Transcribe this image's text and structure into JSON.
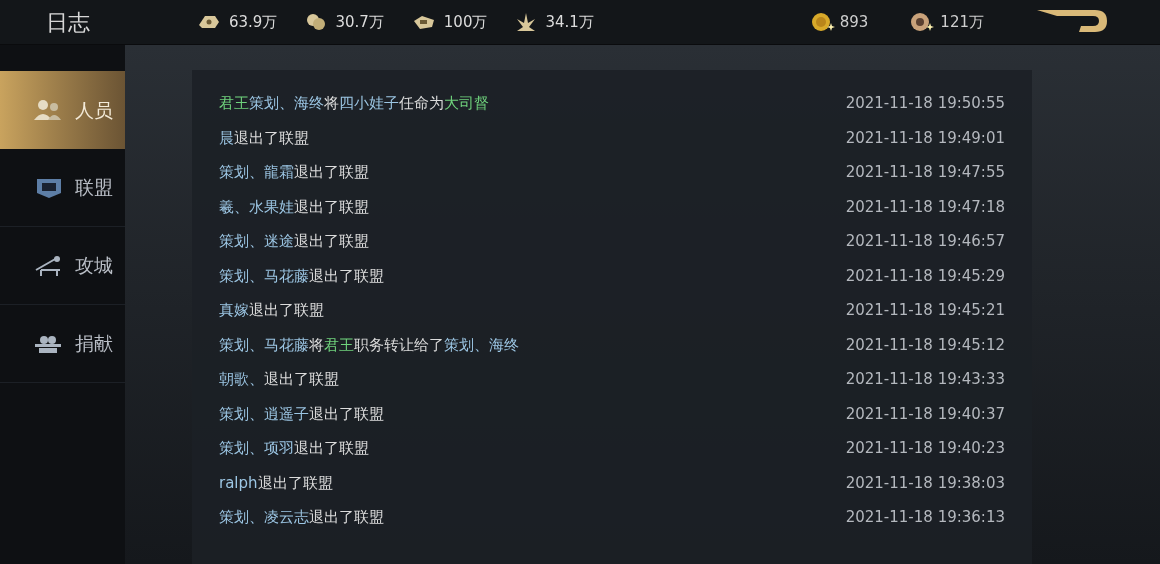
{
  "header": {
    "title": "日志"
  },
  "resources": [
    {
      "kind": "ore",
      "amount": "63.9万"
    },
    {
      "kind": "grain",
      "amount": "30.7万"
    },
    {
      "kind": "iron",
      "amount": "100万"
    },
    {
      "kind": "wood",
      "amount": "34.1万"
    }
  ],
  "currencies": [
    {
      "kind": "gold",
      "amount": "893"
    },
    {
      "kind": "coin",
      "amount": "121万"
    }
  ],
  "sidebar": {
    "items": [
      {
        "kind": "people",
        "label": "人员",
        "selected": true
      },
      {
        "kind": "alliance",
        "label": "联盟",
        "selected": false
      },
      {
        "kind": "siege",
        "label": "攻城",
        "selected": false
      },
      {
        "kind": "donate",
        "label": "捐献",
        "selected": false
      }
    ]
  },
  "log": [
    {
      "segments": [
        {
          "kind": "title",
          "text": "君王"
        },
        {
          "kind": "name",
          "text": "策划、海终"
        },
        {
          "kind": "text",
          "text": "将"
        },
        {
          "kind": "name",
          "text": "四小娃子"
        },
        {
          "kind": "text",
          "text": "任命为"
        },
        {
          "kind": "title",
          "text": "大司督"
        }
      ],
      "time": "2021-11-18 19:50:55"
    },
    {
      "segments": [
        {
          "kind": "name",
          "text": "晨"
        },
        {
          "kind": "text",
          "text": "退出了联盟"
        }
      ],
      "time": "2021-11-18 19:49:01"
    },
    {
      "segments": [
        {
          "kind": "name",
          "text": "策划、龍霜"
        },
        {
          "kind": "text",
          "text": "退出了联盟"
        }
      ],
      "time": "2021-11-18 19:47:55"
    },
    {
      "segments": [
        {
          "kind": "name",
          "text": "羲、水果娃"
        },
        {
          "kind": "text",
          "text": "退出了联盟"
        }
      ],
      "time": "2021-11-18 19:47:18"
    },
    {
      "segments": [
        {
          "kind": "name",
          "text": "策划、迷途"
        },
        {
          "kind": "text",
          "text": "退出了联盟"
        }
      ],
      "time": "2021-11-18 19:46:57"
    },
    {
      "segments": [
        {
          "kind": "name",
          "text": "策划、马花藤"
        },
        {
          "kind": "text",
          "text": "退出了联盟"
        }
      ],
      "time": "2021-11-18 19:45:29"
    },
    {
      "segments": [
        {
          "kind": "name",
          "text": "真嫁"
        },
        {
          "kind": "text",
          "text": "退出了联盟"
        }
      ],
      "time": "2021-11-18 19:45:21"
    },
    {
      "segments": [
        {
          "kind": "name",
          "text": "策划、马花藤"
        },
        {
          "kind": "text",
          "text": "将"
        },
        {
          "kind": "title",
          "text": "君王"
        },
        {
          "kind": "text",
          "text": "职务转让给了"
        },
        {
          "kind": "name",
          "text": "策划、海终"
        }
      ],
      "time": "2021-11-18 19:45:12"
    },
    {
      "segments": [
        {
          "kind": "name",
          "text": "朝歌、"
        },
        {
          "kind": "text",
          "text": "退出了联盟"
        }
      ],
      "time": "2021-11-18 19:43:33"
    },
    {
      "segments": [
        {
          "kind": "name",
          "text": "策划、逍遥子"
        },
        {
          "kind": "text",
          "text": "退出了联盟"
        }
      ],
      "time": "2021-11-18 19:40:37"
    },
    {
      "segments": [
        {
          "kind": "name",
          "text": "策划、项羽"
        },
        {
          "kind": "text",
          "text": "退出了联盟"
        }
      ],
      "time": "2021-11-18 19:40:23"
    },
    {
      "segments": [
        {
          "kind": "name",
          "text": "ralph"
        },
        {
          "kind": "text",
          "text": "退出了联盟"
        }
      ],
      "time": "2021-11-18 19:38:03"
    },
    {
      "segments": [
        {
          "kind": "name",
          "text": "策划、凌云志"
        },
        {
          "kind": "text",
          "text": "退出了联盟"
        }
      ],
      "time": "2021-11-18 19:36:13"
    }
  ]
}
